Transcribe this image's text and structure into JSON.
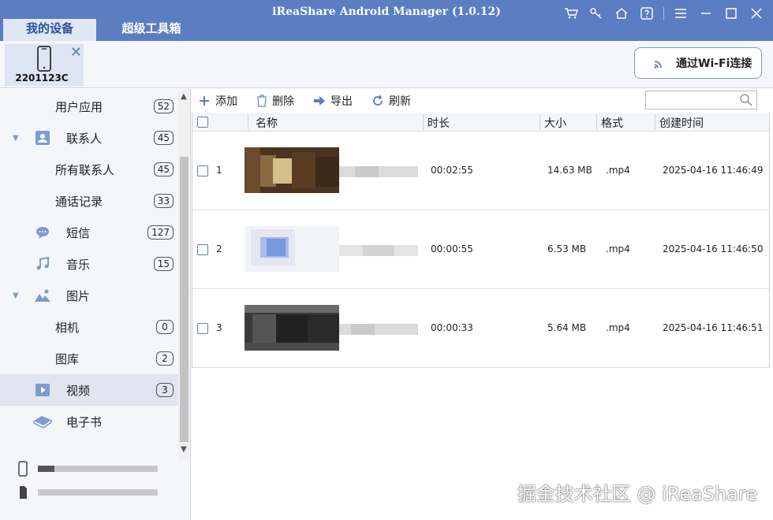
{
  "app": {
    "title": "iReaShare Android Manager (1.0.12)"
  },
  "tabs": [
    {
      "label": "我的设备"
    },
    {
      "label": "超级工具箱"
    }
  ],
  "device": {
    "name": "2201123C"
  },
  "wifi_button": {
    "label": "通过Wi-Fi连接"
  },
  "sidebar": {
    "items": [
      {
        "label": "用户应用",
        "count": "52"
      },
      {
        "label": "联系人",
        "count": "45",
        "icon": "contact-icon"
      },
      {
        "label": "所有联系人",
        "count": "45"
      },
      {
        "label": "通话记录",
        "count": "33"
      },
      {
        "label": "短信",
        "count": "127",
        "icon": "sms-icon"
      },
      {
        "label": "音乐",
        "count": "15",
        "icon": "music-icon"
      },
      {
        "label": "图片",
        "icon": "picture-icon"
      },
      {
        "label": "相机",
        "count": "0"
      },
      {
        "label": "图库",
        "count": "2"
      },
      {
        "label": "视频",
        "count": "3",
        "icon": "video-icon"
      },
      {
        "label": "电子书",
        "icon": "ebook-icon"
      }
    ],
    "storage": [
      {
        "type": "phone-storage",
        "used_fraction": 0.14
      },
      {
        "type": "sd-card",
        "used_fraction": 0.0
      }
    ]
  },
  "toolbar": {
    "add": "添加",
    "delete": "删除",
    "export": "导出",
    "refresh": "刷新"
  },
  "table": {
    "headers": {
      "name": "名称",
      "duration": "时长",
      "size": "大小",
      "format": "格式",
      "created": "创建时间"
    },
    "rows": [
      {
        "index": "1",
        "duration": "00:02:55",
        "size": "14.63 MB",
        "format": ".mp4",
        "created": "2025-04-16 11:46:49"
      },
      {
        "index": "2",
        "duration": "00:00:55",
        "size": "6.53 MB",
        "format": ".mp4",
        "created": "2025-04-16 11:46:50"
      },
      {
        "index": "3",
        "duration": "00:00:33",
        "size": "5.64 MB",
        "format": ".mp4",
        "created": "2025-04-16 11:46:51"
      }
    ]
  },
  "watermark": "掘金技术社区 @ iReaShare",
  "colors": {
    "titlebar": "#5b7dc2",
    "selected": "#e0e5ef"
  }
}
